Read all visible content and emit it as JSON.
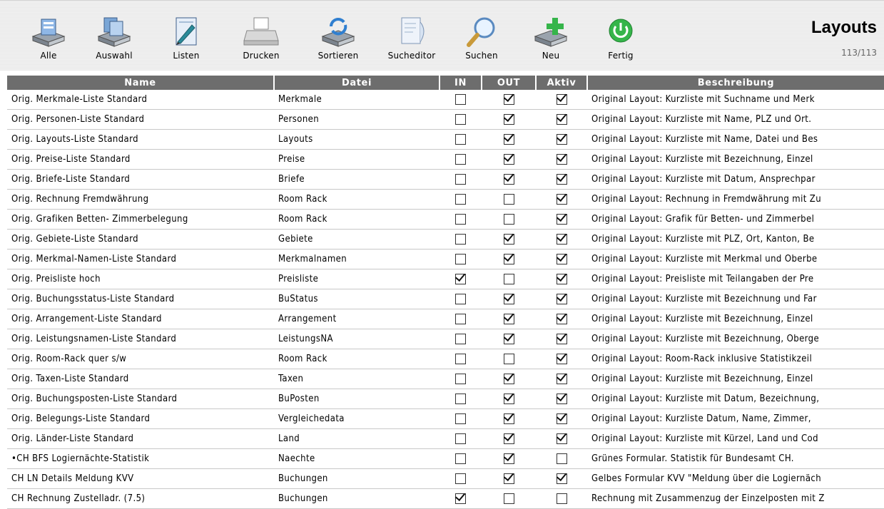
{
  "toolbar": {
    "buttons": [
      {
        "label": "Alle",
        "icon": "all-records-icon"
      },
      {
        "label": "Auswahl",
        "icon": "selection-icon"
      },
      {
        "label": "Listen",
        "icon": "lists-icon"
      },
      {
        "label": "Drucken",
        "icon": "printer-icon"
      },
      {
        "label": "Sortieren",
        "icon": "sort-icon"
      },
      {
        "label": "Sucheditor",
        "icon": "search-editor-icon"
      },
      {
        "label": "Suchen",
        "icon": "magnifier-icon"
      },
      {
        "label": "Neu",
        "icon": "new-record-icon"
      },
      {
        "label": "Fertig",
        "icon": "done-power-icon"
      }
    ],
    "title": "Layouts",
    "count": "113/113"
  },
  "table": {
    "columns": [
      "Name",
      "Datei",
      "IN",
      "OUT",
      "Aktiv",
      "Beschreibung"
    ],
    "rows": [
      {
        "name": "Orig. Merkmale-Liste Standard",
        "datei": "Merkmale",
        "in": false,
        "out": true,
        "aktiv": true,
        "desc": "Original Layout: Kurzliste mit Suchname und Merk"
      },
      {
        "name": "Orig. Personen-Liste Standard",
        "datei": "Personen",
        "in": false,
        "out": true,
        "aktiv": true,
        "desc": "Original Layout: Kurzliste mit Name, PLZ und Ort."
      },
      {
        "name": "Orig. Layouts-Liste Standard",
        "datei": "Layouts",
        "in": false,
        "out": true,
        "aktiv": true,
        "desc": "Original Layout: Kurzliste mit Name, Datei und Bes"
      },
      {
        "name": "Orig. Preise-Liste Standard",
        "datei": "Preise",
        "in": false,
        "out": true,
        "aktiv": true,
        "desc": "Original Layout: Kurzliste mit Bezeichnung, Einzel"
      },
      {
        "name": "Orig. Briefe-Liste Standard",
        "datei": "Briefe",
        "in": false,
        "out": true,
        "aktiv": true,
        "desc": "Original Layout: Kurzliste mit Datum, Ansprechpar"
      },
      {
        "name": "Orig. Rechnung Fremdwährung",
        "datei": "Room Rack",
        "in": false,
        "out": false,
        "aktiv": true,
        "desc": "Original Layout: Rechnung in Fremdwährung mit Zu"
      },
      {
        "name": "Orig. Grafiken Betten- Zimmerbelegung",
        "datei": "Room Rack",
        "in": false,
        "out": false,
        "aktiv": true,
        "desc": "Original Layout: Grafik für Betten- und Zimmerbel"
      },
      {
        "name": "Orig. Gebiete-Liste Standard",
        "datei": "Gebiete",
        "in": false,
        "out": true,
        "aktiv": true,
        "desc": "Original Layout: Kurzliste mit PLZ, Ort, Kanton, Be"
      },
      {
        "name": "Orig. Merkmal-Namen-Liste Standard",
        "datei": "Merkmalnamen",
        "in": false,
        "out": true,
        "aktiv": true,
        "desc": "Original Layout: Kurzliste mit Merkmal und Oberbe"
      },
      {
        "name": "Orig. Preisliste hoch",
        "datei": "Preisliste",
        "in": true,
        "out": false,
        "aktiv": true,
        "desc": "Original Layout: Preisliste mit Teilangaben der Pre"
      },
      {
        "name": "Orig. Buchungsstatus-Liste Standard",
        "datei": "BuStatus",
        "in": false,
        "out": true,
        "aktiv": true,
        "desc": "Original Layout: Kurzliste mit Bezeichnung und Far"
      },
      {
        "name": "Orig. Arrangement-Liste Standard",
        "datei": "Arrangement",
        "in": false,
        "out": true,
        "aktiv": true,
        "desc": "Original Layout: Kurzliste mit Bezeichnung, Einzel"
      },
      {
        "name": "Orig. Leistungsnamen-Liste Standard",
        "datei": "LeistungsNA",
        "in": false,
        "out": true,
        "aktiv": true,
        "desc": "Original Layout: Kurzliste mit Bezeichnung, Oberge"
      },
      {
        "name": "Orig. Room-Rack quer s/w",
        "datei": "Room Rack",
        "in": false,
        "out": false,
        "aktiv": true,
        "desc": "Original Layout: Room-Rack inklusive Statistikzeil"
      },
      {
        "name": "Orig. Taxen-Liste Standard",
        "datei": "Taxen",
        "in": false,
        "out": true,
        "aktiv": true,
        "desc": "Original Layout: Kurzliste mit Bezeichnung, Einzel"
      },
      {
        "name": "Orig. Buchungsposten-Liste Standard",
        "datei": "BuPosten",
        "in": false,
        "out": true,
        "aktiv": true,
        "desc": "Original Layout: Kurzliste mit Datum, Bezeichnung,"
      },
      {
        "name": "Orig. Belegungs-Liste Standard",
        "datei": "Vergleichedata",
        "in": false,
        "out": true,
        "aktiv": true,
        "desc": "Original Layout: Kurzliste Datum, Name, Zimmer,"
      },
      {
        "name": "Orig. Länder-Liste Standard",
        "datei": "Land",
        "in": false,
        "out": true,
        "aktiv": true,
        "desc": "Original Layout: Kurzliste mit Kürzel, Land und Cod"
      },
      {
        "name": "•CH BFS Logiernächte-Statistik",
        "datei": "Naechte",
        "in": false,
        "out": true,
        "aktiv": false,
        "desc": "Grünes Formular. Statistik für Bundesamt CH."
      },
      {
        "name": "CH LN Details Meldung KVV",
        "datei": "Buchungen",
        "in": false,
        "out": true,
        "aktiv": true,
        "desc": "Gelbes Formular KVV \"Meldung über die Logiernäch"
      },
      {
        "name": "CH Rechnung Zustelladr. (7.5)",
        "datei": "Buchungen",
        "in": true,
        "out": false,
        "aktiv": false,
        "desc": "Rechnung mit Zusammenzug der Einzelposten mit Z"
      }
    ]
  }
}
